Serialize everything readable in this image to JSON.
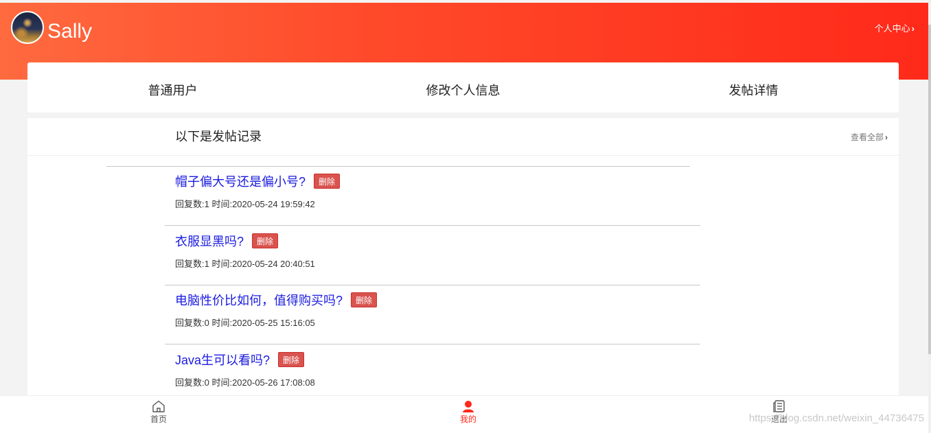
{
  "header": {
    "username": "Sally",
    "personal_center": "个人中心"
  },
  "tabs": [
    {
      "label": "普通用户"
    },
    {
      "label": "修改个人信息"
    },
    {
      "label": "发帖详情"
    }
  ],
  "section": {
    "title": "以下是发帖记录",
    "view_all": "查看全部"
  },
  "posts": [
    {
      "title": "帽子偏大号还是偏小号?",
      "delete_label": "删除",
      "meta": "回复数:1 时间:2020-05-24 19:59:42"
    },
    {
      "title": "衣服显黑吗?",
      "delete_label": "删除",
      "meta": "回复数:1 时间:2020-05-24 20:40:51"
    },
    {
      "title": "电脑性价比如何，值得购买吗?",
      "delete_label": "删除",
      "meta": "回复数:0 时间:2020-05-25 15:16:05"
    },
    {
      "title": "Java生可以看吗?",
      "delete_label": "删除",
      "meta": "回复数:0 时间:2020-05-26 17:08:08"
    }
  ],
  "bottom_nav": {
    "home": "首页",
    "mine": "我的",
    "exit": "退出"
  },
  "watermark": "https://blog.csdn.net/weixin_44736475",
  "colors": {
    "header_start": "#ff6a3f",
    "header_end": "#ff2a1a",
    "post_title": "#1a1ae0",
    "delete_button": "#d9534f",
    "active_nav": "#ff2a1a"
  }
}
